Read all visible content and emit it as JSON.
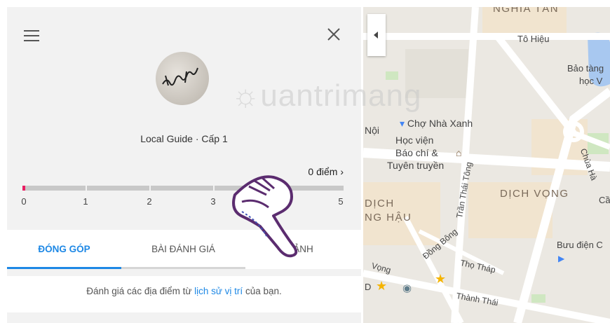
{
  "panel": {
    "avatar_text": "부러운",
    "guide_label": "Local Guide · Cấp 1",
    "points": "0 điểm ›",
    "progress_value": 0,
    "progress_ticks": [
      "0",
      "1",
      "2",
      "3",
      "4",
      "5"
    ],
    "tabs": [
      {
        "label": "ĐÓNG GÓP",
        "active": true
      },
      {
        "label": "BÀI ĐÁNH GIÁ",
        "active": false
      },
      {
        "label": "ẢNH",
        "active": false
      }
    ],
    "content": {
      "prefix": "Đánh giá các địa điểm từ ",
      "link": "lịch sử vị trí",
      "suffix": " của bạn."
    },
    "colors": {
      "accent": "#1e88e5",
      "progress": "#e91e63"
    }
  },
  "map": {
    "labels": {
      "nghia_tan": "NGHĨA TÂN",
      "to_hieu": "Tô Hiệu",
      "bao_tang_1": "Bảo tàng",
      "bao_tang_2": "học V",
      "cho_nha_xanh": "Chợ Nhà Xanh",
      "noi": "Nội",
      "hoc_vien": "Học viện",
      "bao_chi": "Báo chí &",
      "tuyen_truyen": "Tuyên truyền",
      "dich_vong": "DỊCH VỌNG",
      "dich": "DỊCH",
      "ng_hau": "NG HẬU",
      "tran_thai_tong": "Trần Thái Tông",
      "dong_bong": "Đồng Bông",
      "tho_thap": "Thọ Tháp",
      "thanh_thai": "Thành Thái",
      "buu_dien": "Bưu điện C",
      "chua_ha": "Chùa Hà",
      "vong": "Vọng",
      "ca": "Cầ",
      "d": "D"
    }
  },
  "watermark": "uantrimang"
}
